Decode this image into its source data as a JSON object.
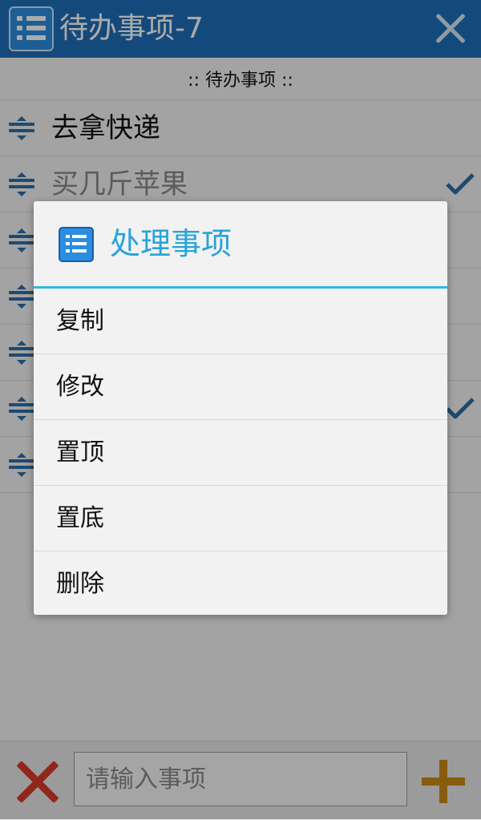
{
  "app": {
    "title": "待办事项-7",
    "close_icon": "close-icon",
    "list_header": ":: 待办事项 ::"
  },
  "todos": [
    {
      "text": "去拿快递",
      "done": false
    },
    {
      "text": "买几斤苹果",
      "done": true
    },
    {
      "text": "",
      "done": false
    },
    {
      "text": "",
      "done": false
    },
    {
      "text": "",
      "done": false
    },
    {
      "text": "",
      "done": true
    },
    {
      "text": "",
      "done": false
    }
  ],
  "bottom": {
    "input_placeholder": "请输入事项",
    "clear_icon": "clear-x-icon",
    "add_icon": "add-plus-icon"
  },
  "dialog": {
    "title": "处理事项",
    "items": [
      "复制",
      "修改",
      "置顶",
      "置底",
      "删除"
    ]
  },
  "colors": {
    "titlebar": "#1e6fb8",
    "accent": "#33b5e5",
    "dialog_title": "#2aa3d8",
    "clear": "#d93a2b",
    "add": "#c98a12",
    "check": "#2f6fa8"
  }
}
